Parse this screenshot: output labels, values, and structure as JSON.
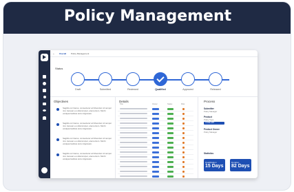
{
  "banner": {
    "title": "Policy Management"
  },
  "tabs": {
    "back": "←",
    "items": [
      "Overall",
      "Policy Management"
    ]
  },
  "status": {
    "label": "Status"
  },
  "steps": [
    {
      "name": "Draft",
      "state": "pending"
    },
    {
      "name": "Submitted",
      "state": "pending"
    },
    {
      "name": "Reviewed",
      "state": "pending"
    },
    {
      "name": "Qualified",
      "state": "done"
    },
    {
      "name": "Approved",
      "state": "pending"
    },
    {
      "name": "Released",
      "state": "pending"
    }
  ],
  "objectives": {
    "title": "Objectives",
    "items": [
      "Sagittis orci lacus, consectetur at bibendum id tempor nisi. Aenean eu ullamcorper, elementum. Morbi volutpat facilisis tortor dignissim.",
      "Sagittis orci lacus, consectetur at bibendum id tempor nisi. Aenean eu ullamcorper, elementum. Morbi volutpat facilisis tortor dignissim.",
      "Sagittis orci lacus, consectetur at bibendum id tempor nisi. Aenean eu ullamcorper, elementum. Morbi volutpat facilisis tortor dignissim.",
      "Sagittis orci lacus, consectetur at bibendum id tempor nisi. Aenean eu ullamcorper, elementum. Morbi volutpat facilisis tortor dignissim."
    ]
  },
  "details": {
    "title": "Details",
    "headers": [
      "Title",
      "Owner",
      "Status",
      "Risk"
    ],
    "row_count": 15
  },
  "process": {
    "title": "Process",
    "fields": [
      {
        "label": "Submitter",
        "value": "Policy Manager"
      },
      {
        "label": "Product",
        "value": "Policy Type",
        "bar": "CORE APP"
      },
      {
        "label": "Product Owner",
        "value": "Policy Manager"
      }
    ],
    "stats_title": "Statistics",
    "stats": [
      {
        "label": "Qualification",
        "value": "15 Days"
      },
      {
        "label": "Duration",
        "value": "82 Days"
      }
    ]
  },
  "colors": {
    "navy": "#1f2a44",
    "blue": "#1e4fb3",
    "step_blue": "#2f67d6"
  },
  "icons": [
    "logo-icon",
    "home-icon",
    "globe-icon",
    "document-icon",
    "search-icon",
    "chart-icon",
    "eye-icon",
    "users-icon",
    "avatar-icon"
  ]
}
